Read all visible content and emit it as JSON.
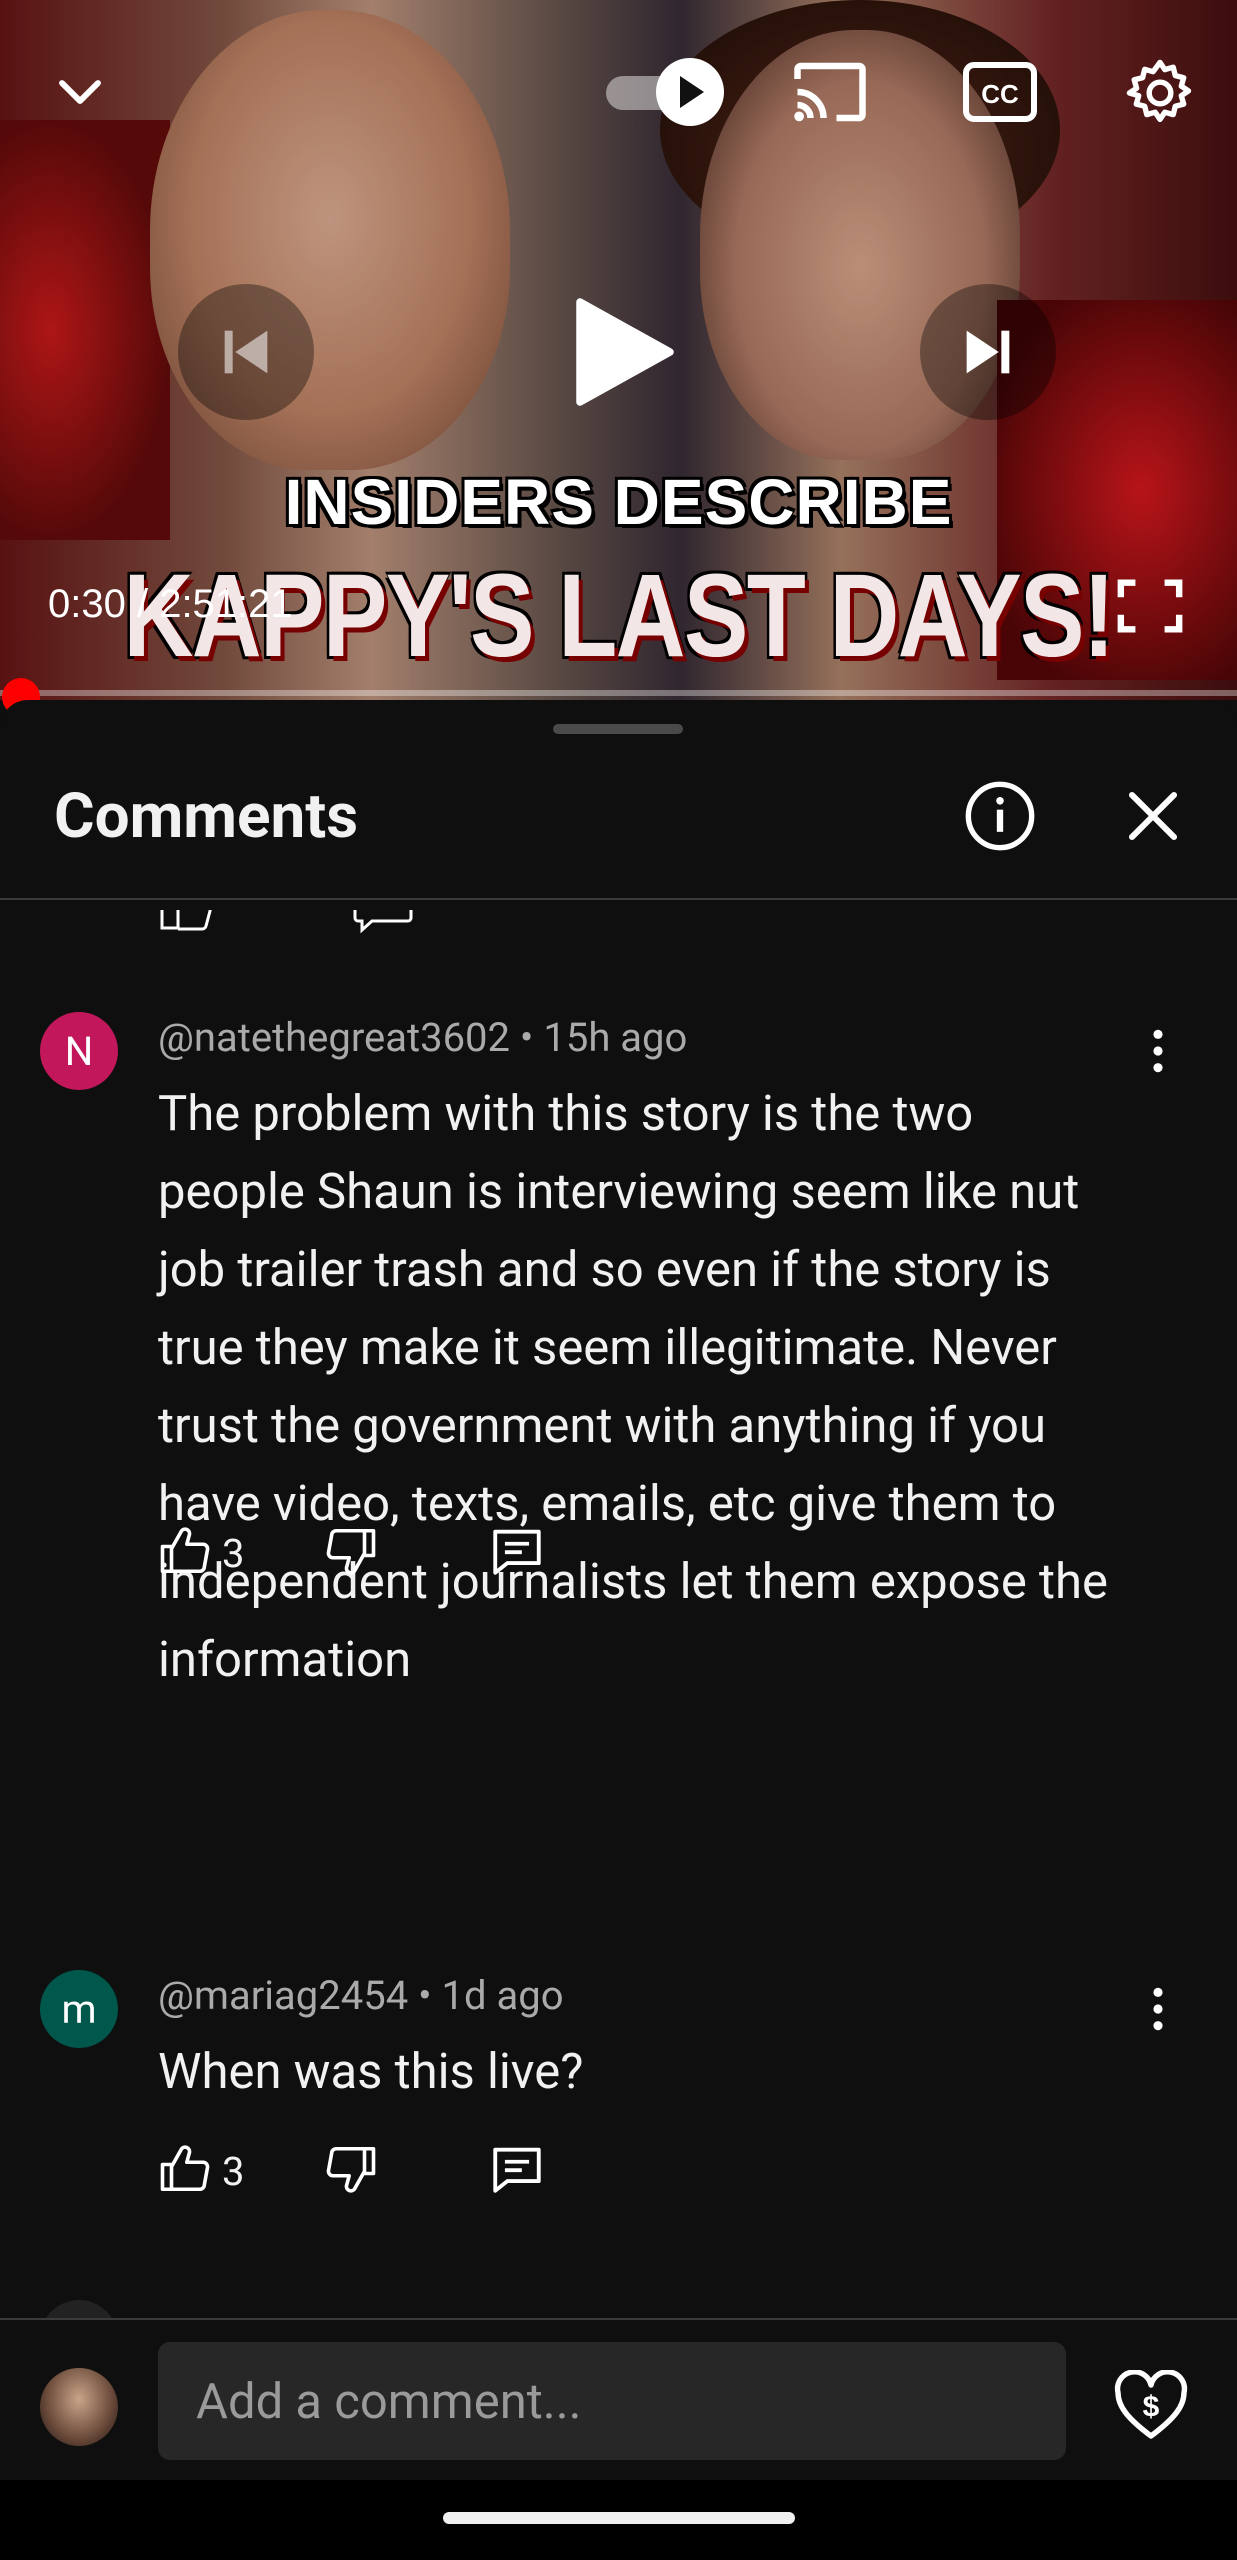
{
  "player": {
    "headline_top": "INSIDERS DESCRIBE",
    "headline_bottom": "KAPPY'S LAST DAYS!",
    "current_time": "0:30",
    "duration": "2:51:21",
    "time_display": "0:30 / 2:51:21",
    "progress_fraction": 0.003,
    "icons": {
      "minimize": "chevron-down-icon",
      "autoplay": "autoplay-toggle-icon",
      "cast": "cast-icon",
      "captions": "cc-icon",
      "settings": "gear-icon",
      "previous": "skip-previous-icon",
      "play": "play-icon",
      "next": "skip-next-icon",
      "fullscreen": "fullscreen-icon"
    }
  },
  "comments_panel": {
    "title": "Comments",
    "comments": [
      {
        "avatar_letter": "N",
        "avatar_color": "#c2185b",
        "author": "@natethegreat3602",
        "age": "15h ago",
        "meta": "@natethegreat3602 • 15h ago",
        "text": "The problem with this story is the two people Shaun is interviewing seem like nut job trailer trash and so even if the story is true they make it seem illegitimate. Never trust the government with anything if you have video, texts, emails, etc give them to independent journalists let them expose the information",
        "likes": "3"
      },
      {
        "avatar_letter": "m",
        "avatar_color": "#00574b",
        "author": "@mariag2454",
        "age": "1d ago",
        "meta": "@mariag2454 • 1d ago",
        "text": "When was this live?",
        "likes": "3"
      }
    ]
  },
  "composer": {
    "placeholder": "Add a comment..."
  },
  "colors": {
    "background": "#0f0f0f",
    "progress": "#ff0000",
    "input_bg": "#272727"
  }
}
